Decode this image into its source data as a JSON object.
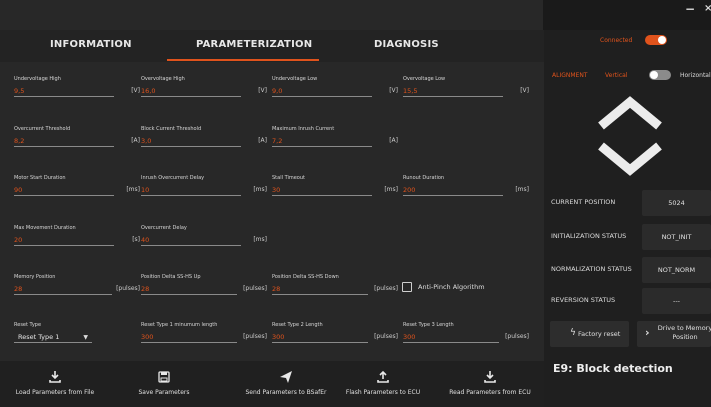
{
  "tabs": [
    "INFORMATION",
    "PARAMETERIZATION",
    "DIAGNOSIS"
  ],
  "fields": [
    {
      "label": "Undervoltage High",
      "value": "9,5",
      "unit": "[V]"
    },
    {
      "label": "Overvoltage High",
      "value": "16,0",
      "unit": "[V]"
    },
    {
      "label": "Undervoltage Low",
      "value": "9,0",
      "unit": "[V]"
    },
    {
      "label": "Overvoltage Low",
      "value": "15,5",
      "unit": "[V]"
    },
    {
      "label": "Overcurrent Threshold",
      "value": "8,2",
      "unit": "[A]"
    },
    {
      "label": "Block Current Threshold",
      "value": "3,0",
      "unit": "[A]"
    },
    {
      "label": "Maximum Inrush Current",
      "value": "7,2",
      "unit": "[A]"
    },
    {
      "label": "Motor Start Duration",
      "value": "90",
      "unit": "[ms]"
    },
    {
      "label": "Inrush Overcurrent Delay",
      "value": "10",
      "unit": "[ms]"
    },
    {
      "label": "Stall Timeout",
      "value": "30",
      "unit": "[ms]"
    },
    {
      "label": "Runout Duration",
      "value": "200",
      "unit": "[ms]"
    },
    {
      "label": "Max Movement Duration",
      "value": "20",
      "unit": "[s]"
    },
    {
      "label": "Overcurrent Delay",
      "value": "40",
      "unit": "[ms]"
    },
    {
      "label": "Memory Position",
      "value": "28",
      "unit": "[pulses]"
    },
    {
      "label": "Position Delta SS-HS Up",
      "value": "28",
      "unit": "[pulses]"
    },
    {
      "label": "Position Delta SS-HS Down",
      "value": "28",
      "unit": "[pulses]"
    },
    {
      "label": "Reset Type 1 minumum length",
      "value": "300",
      "unit": "[pulses]"
    },
    {
      "label": "Reset Type 2 Length",
      "value": "300",
      "unit": "[pulses]"
    },
    {
      "label": "Reset Type 3 Length",
      "value": "300",
      "unit": "[pulses]"
    }
  ],
  "anti_pinch_label": "Anti-Pinch Algorithm",
  "anti_pinch_checked": false,
  "reset_type": {
    "label": "Reset Type",
    "selected": "Reset Type 1"
  },
  "toolbar": [
    {
      "label": "Load Parameters from File",
      "icon": "download-icon"
    },
    {
      "label": "Save Parameters",
      "icon": "floppy-disk-icon"
    },
    {
      "label": "Send Parameters to BSafEr",
      "icon": "paper-plane-icon"
    },
    {
      "label": "Flash Parameters to ECU",
      "icon": "upload-icon"
    },
    {
      "label": "Read Parameters from ECU",
      "icon": "download-icon"
    }
  ],
  "window": {
    "minimize": "−",
    "close": "×"
  },
  "status": {
    "connected_label": "Connected",
    "connected_on": true
  },
  "alignment": {
    "label": "ALIGNMENT",
    "vertical": "Vertical",
    "horizontal": "Horizontal",
    "is_horizontal": false
  },
  "status_rows": [
    {
      "label": "CURRENT POSITION",
      "value": "5024"
    },
    {
      "label": "INITIALIZATION STATUS",
      "value": "NOT_INIT"
    },
    {
      "label": "NORMALIZATION STATUS",
      "value": "NOT_NORM"
    },
    {
      "label": "REVERSION STATUS",
      "value": "---"
    }
  ],
  "buttons": {
    "factory_reset": "Factory reset",
    "drive_to_memory": "Drive to Memory Position"
  },
  "error_title": "E9: Block detection",
  "colors": {
    "accent": "#e0531c",
    "background": "#282828",
    "panel": "#1f1f1f"
  }
}
